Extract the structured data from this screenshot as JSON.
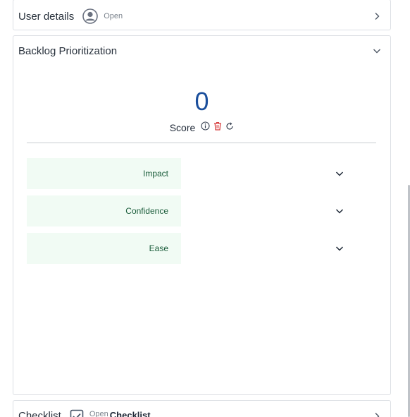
{
  "user_details": {
    "title": "User details",
    "icon": "user-circle-icon",
    "status": "Open"
  },
  "backlog": {
    "title": "Backlog Prioritization",
    "score": {
      "value": "0",
      "label": "Score",
      "icons": [
        "info-icon",
        "trash-icon",
        "refresh-icon"
      ]
    },
    "factors": [
      {
        "label": "Impact"
      },
      {
        "label": "Confidence"
      },
      {
        "label": "Ease"
      }
    ]
  },
  "checklist": {
    "title": "Checklist",
    "icon": "checkbox-icon",
    "status": "Open",
    "bold_label": "Checklist"
  },
  "colors": {
    "score_blue": "#1b4f9c",
    "factor_bg": "#f1fbf4",
    "factor_text": "#1a5c3a",
    "danger": "#d63a3a"
  }
}
